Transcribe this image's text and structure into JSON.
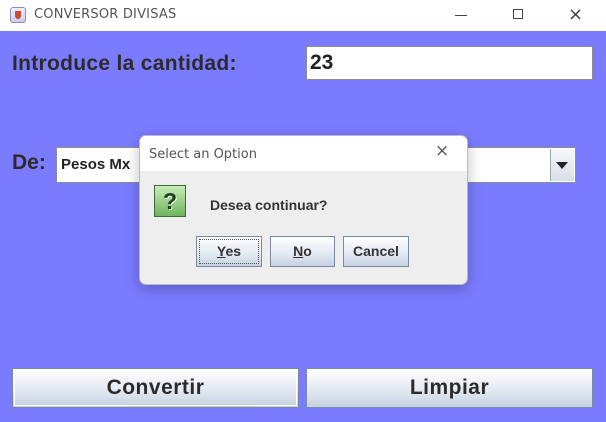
{
  "window": {
    "title": "CONVERSOR DIVISAS",
    "icon": "java-coffee-icon",
    "controls": {
      "minimize": "minimize-icon",
      "maximize": "maximize-icon",
      "close": "×"
    }
  },
  "form": {
    "amount_label": "Introduce la cantidad:",
    "amount_value": "23",
    "from_label": "De:",
    "from_selected": "Pesos Mx"
  },
  "buttons": {
    "convert": "Convertir",
    "clear": "Limpiar"
  },
  "dialog": {
    "title": "Select an Option",
    "close": "×",
    "icon": "question-icon",
    "icon_glyph": "?",
    "message": "Desea continuar?",
    "yes": "Yes",
    "no": "No",
    "cancel": "Cancel"
  },
  "colors": {
    "background": "#7b7bff",
    "dialog_background": "#eeeeee",
    "question_icon": "#6fb35d"
  }
}
